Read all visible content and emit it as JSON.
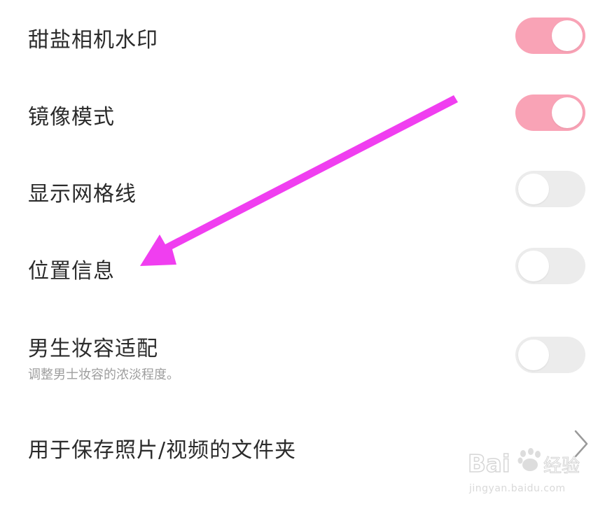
{
  "settings": [
    {
      "label": "甜盐相机水印",
      "state": "on"
    },
    {
      "label": "镜像模式",
      "state": "on"
    },
    {
      "label": "显示网格线",
      "state": "off"
    },
    {
      "label": "位置信息",
      "state": "off"
    },
    {
      "label": "男生妆容适配",
      "sublabel": "调整男士妆容的浓淡程度。",
      "state": "off"
    }
  ],
  "folder_row": {
    "label": "用于保存照片/视频的文件夹"
  },
  "watermark": {
    "logo": "Bai经验",
    "url": "jingyan.baidu.com"
  },
  "colors": {
    "toggle_on": "#f9a3b6",
    "toggle_off": "#ececec",
    "annotation_arrow": "#f03ef0"
  },
  "icons": {
    "folder_row_icon": "chevron-right-icon",
    "annotation": "arrow-pointer-icon"
  }
}
